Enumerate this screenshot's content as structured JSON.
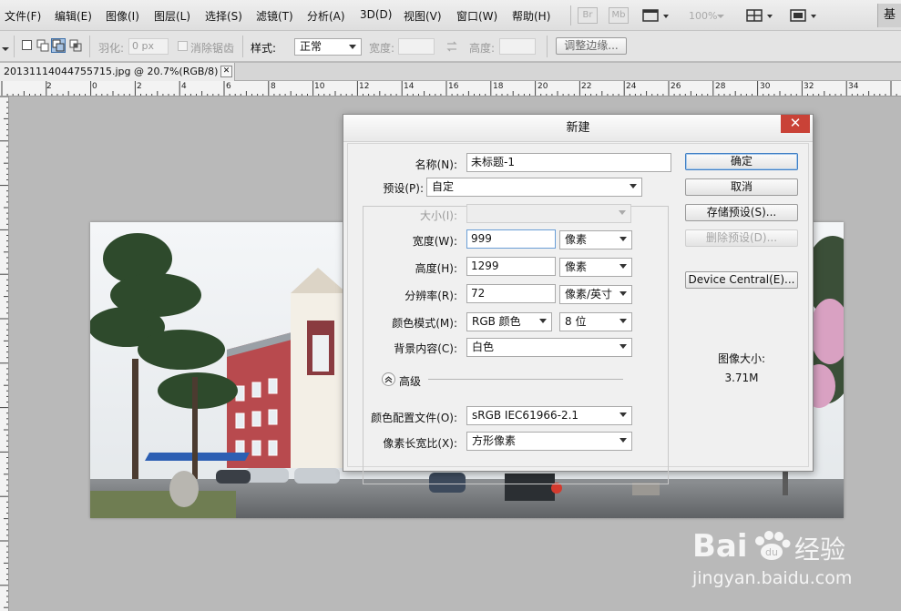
{
  "menubar": {
    "items": [
      "文件(F)",
      "编辑(E)",
      "图像(I)",
      "图层(L)",
      "选择(S)",
      "滤镜(T)",
      "分析(A)",
      "3D(D)",
      "视图(V)",
      "窗口(W)",
      "帮助(H)"
    ],
    "br_label": "Br",
    "mb_label": "Mb",
    "zoom": "100%",
    "workspace": "基"
  },
  "options": {
    "feather_label": "羽化:",
    "feather_value": "0 px",
    "antialias_label": "消除锯齿",
    "style_label": "样式:",
    "style_value": "正常",
    "width_label": "宽度:",
    "height_label": "高度:",
    "refine_edge": "调整边缘..."
  },
  "document": {
    "tab_title": "20131114044755715.jpg @ 20.7%(RGB/8)",
    "tab_close": "✕"
  },
  "ruler": {
    "labels": [
      "2",
      "0",
      "2",
      "4",
      "6",
      "8",
      "10",
      "12",
      "14",
      "16",
      "18",
      "20",
      "22",
      "24",
      "26",
      "28",
      "30",
      "32",
      "34"
    ]
  },
  "dialog": {
    "title": "新建",
    "close": "✕",
    "name_label": "名称(N):",
    "name_value": "未标题-1",
    "preset_label": "预设(P):",
    "preset_value": "自定",
    "size_label": "大小(I):",
    "width_label": "宽度(W):",
    "width_value": "999",
    "width_unit": "像素",
    "height_label": "高度(H):",
    "height_value": "1299",
    "height_unit": "像素",
    "resolution_label": "分辨率(R):",
    "resolution_value": "72",
    "resolution_unit": "像素/英寸",
    "color_mode_label": "颜色模式(M):",
    "color_mode_value": "RGB 颜色",
    "bit_depth": "8 位",
    "background_label": "背景内容(C):",
    "background_value": "白色",
    "advanced_label": "高级",
    "profile_label": "颜色配置文件(O):",
    "profile_value": "sRGB IEC61966-2.1",
    "aspect_label": "像素长宽比(X):",
    "aspect_value": "方形像素",
    "buttons": {
      "ok": "确定",
      "cancel": "取消",
      "save_preset": "存储预设(S)...",
      "delete_preset": "删除预设(D)...",
      "device_central": "Device Central(E)..."
    },
    "image_size_label": "图像大小:",
    "image_size_value": "3.71M"
  },
  "watermark": {
    "brand": "Bai",
    "brand_tail": "经验",
    "url": "jingyan.baidu.com"
  },
  "colors": {
    "accent": "#3f7fc4",
    "close_red": "#c94237",
    "canvas_bg": "#b9b9b9"
  }
}
